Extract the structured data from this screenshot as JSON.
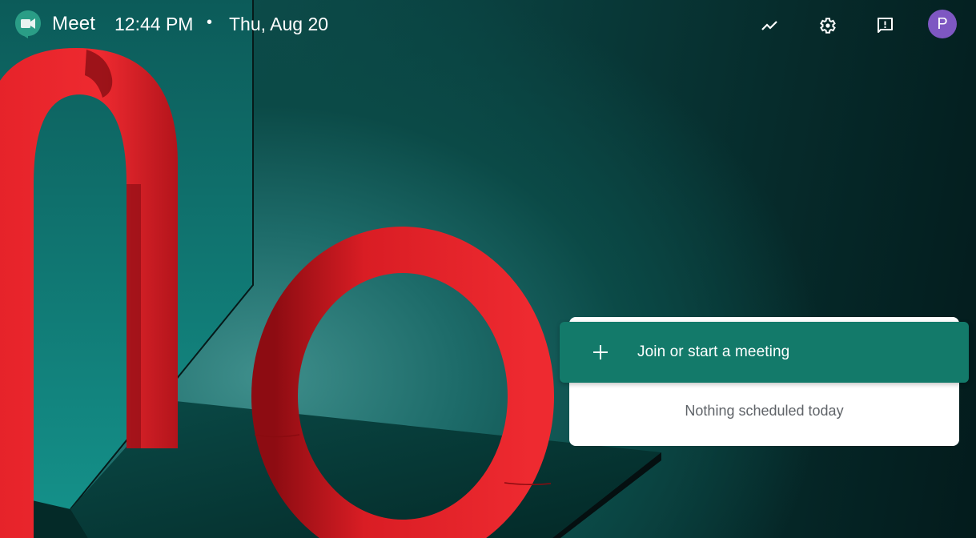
{
  "header": {
    "app_name": "Meet",
    "time": "12:44 PM",
    "separator": "•",
    "date": "Thu, Aug 20",
    "icons": [
      {
        "name": "trending-icon",
        "label": "Activity"
      },
      {
        "name": "settings-icon",
        "label": "Settings"
      },
      {
        "name": "feedback-icon",
        "label": "Feedback"
      }
    ],
    "avatar_initial": "P"
  },
  "main": {
    "join_button_label": "Join or start a meeting",
    "schedule_empty_text": "Nothing scheduled today"
  },
  "colors": {
    "brand_green": "#137a6a",
    "avatar_purple": "#7e57c2",
    "background_teal": "#0a4140",
    "sculpture_red": "#e8222b"
  }
}
